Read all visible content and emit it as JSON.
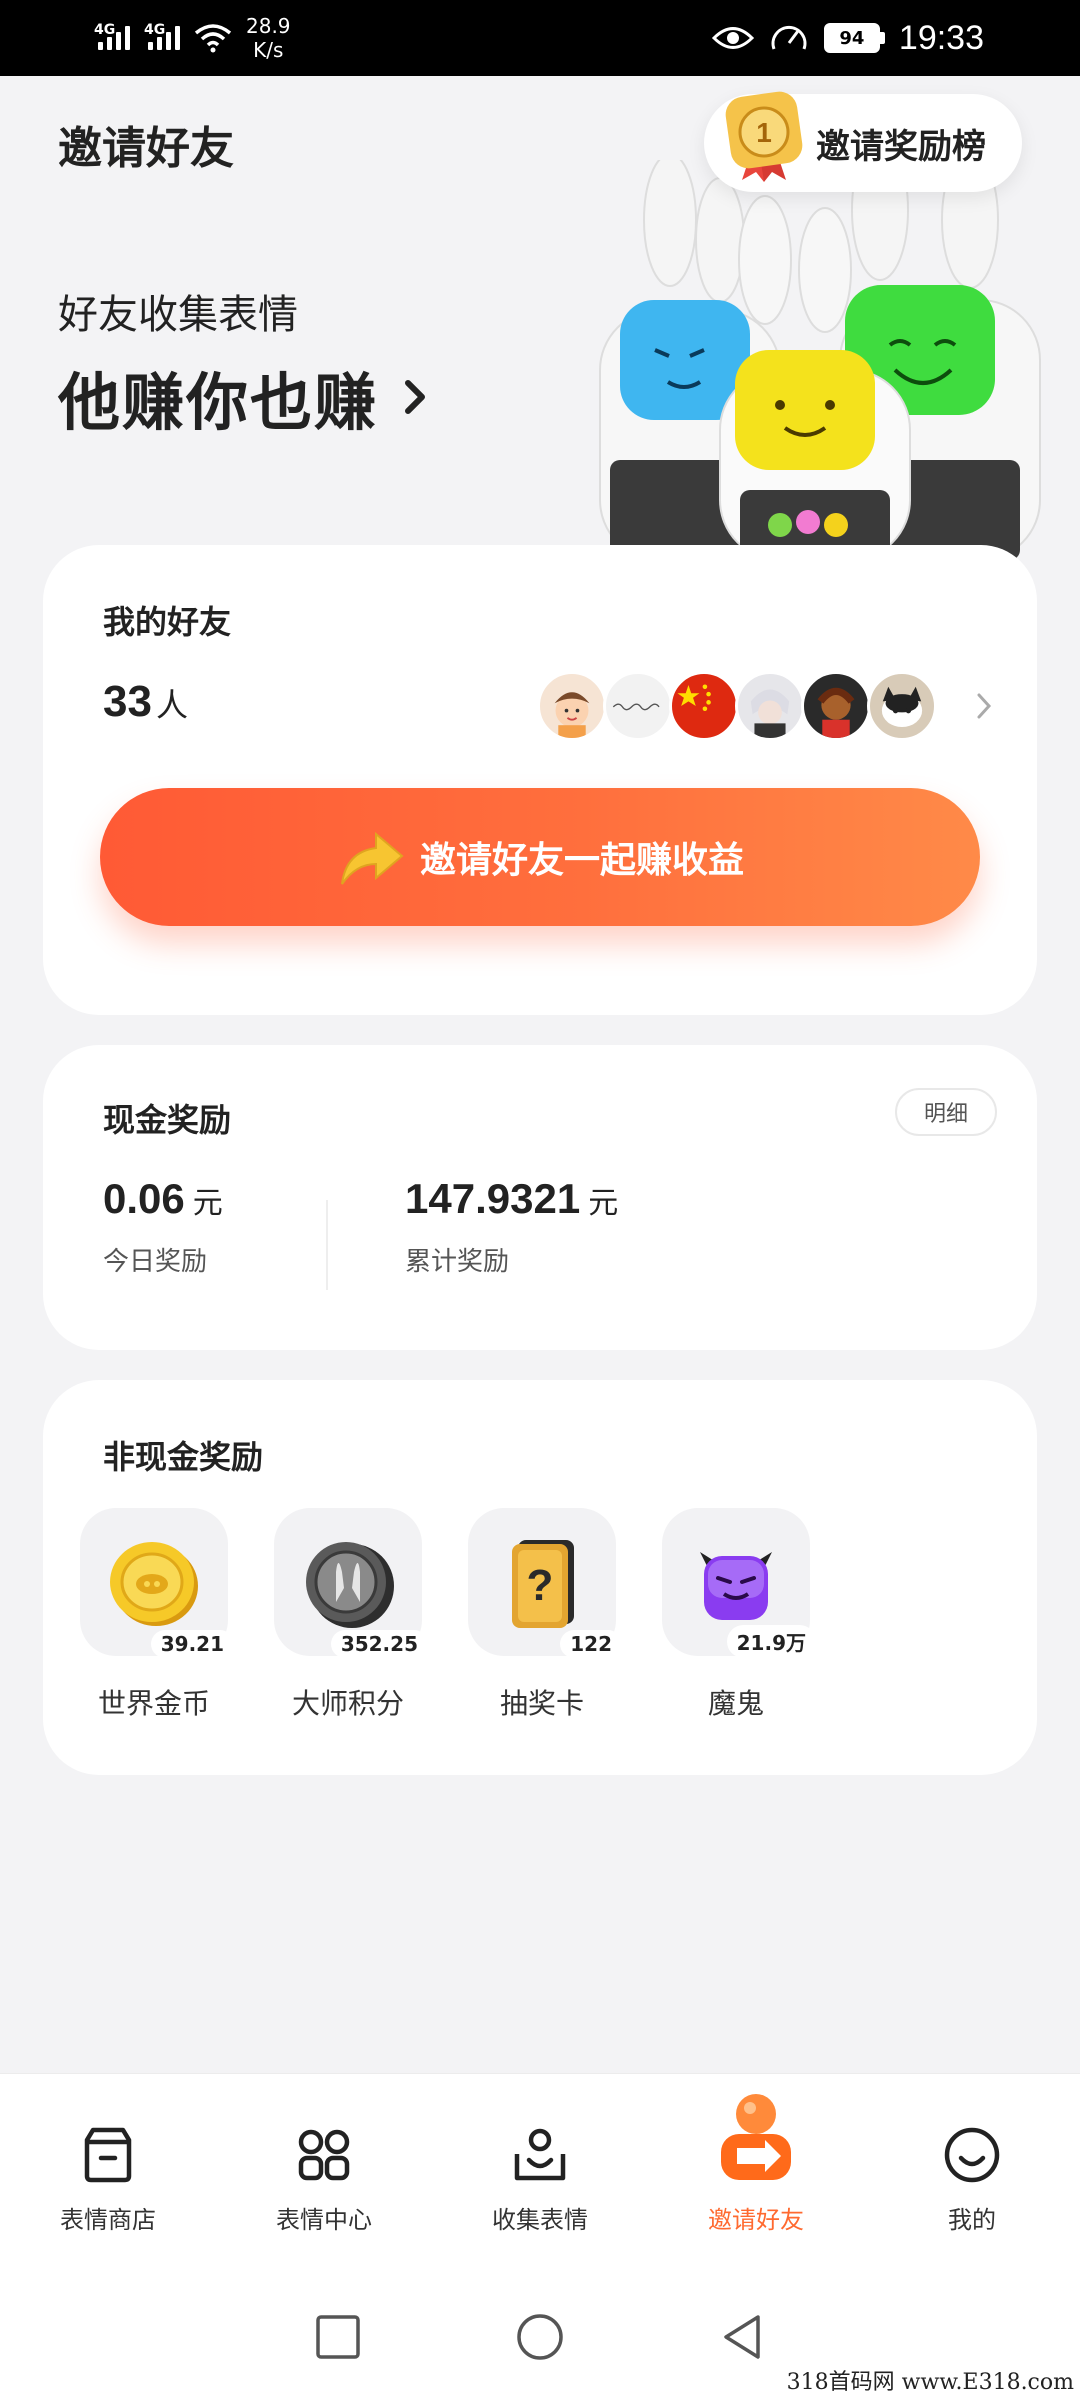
{
  "status_bar": {
    "net_type_1": "4G",
    "net_type_2": "4G",
    "net_speed_value": "28.9",
    "net_speed_unit": "K/s",
    "battery_level": "94",
    "time": "19:33"
  },
  "header": {
    "title": "邀请好友",
    "rank_button_label": "邀请奖励榜",
    "rank_medal_number": "1",
    "hero_subtitle": "好友收集表情",
    "hero_title": "他赚你也赚"
  },
  "friends": {
    "title": "我的好友",
    "count": "33",
    "count_unit": "人",
    "invite_button_label": "邀请好友一起赚收益",
    "avatar_names": [
      "avatar-cartoon-boy",
      "avatar-handwriting",
      "avatar-flag",
      "avatar-anime",
      "avatar-figure",
      "avatar-cat"
    ]
  },
  "cash": {
    "title": "现金奖励",
    "detail_label": "明细",
    "today_value": "0.06",
    "today_unit": "元",
    "today_label": "今日奖励",
    "total_value": "147.9321",
    "total_unit": "元",
    "total_label": "累计奖励"
  },
  "non_cash": {
    "title": "非现金奖励",
    "items": [
      {
        "name": "世界金币",
        "value": "39.21",
        "icon": "gold-coin-icon"
      },
      {
        "name": "大师积分",
        "value": "352.25",
        "icon": "master-points-icon"
      },
      {
        "name": "抽奖卡",
        "value": "122",
        "icon": "lottery-card-icon"
      },
      {
        "name": "魔鬼",
        "value": "21.9万",
        "icon": "devil-icon"
      }
    ]
  },
  "bottom_nav": {
    "items": [
      {
        "label": "表情商店",
        "icon": "store-icon"
      },
      {
        "label": "表情中心",
        "icon": "grid-icon"
      },
      {
        "label": "收集表情",
        "icon": "collect-icon"
      },
      {
        "label": "邀请好友",
        "icon": "invite-icon"
      },
      {
        "label": "我的",
        "icon": "smile-face-icon"
      }
    ],
    "active_index": 3
  },
  "watermark": "318首码网 www.E318.com",
  "colors": {
    "accent": "#ff6a30",
    "button_start": "#ff5a35",
    "button_end": "#ff8a48",
    "background": "#f3f3f5"
  }
}
